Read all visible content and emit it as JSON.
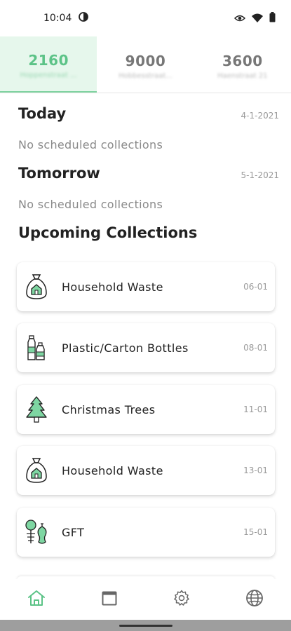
{
  "status_bar": {
    "time": "10:04",
    "icons": [
      "sync-icon",
      "eye-icon",
      "wifi-icon",
      "battery-icon"
    ]
  },
  "address_tabs": [
    {
      "number": "2160",
      "subtitle": "Hoppenstraat ...",
      "active": true
    },
    {
      "number": "9000",
      "subtitle": "Hobbesstraat...",
      "active": false
    },
    {
      "number": "3600",
      "subtitle": "Haenstraat 21",
      "active": false
    }
  ],
  "today": {
    "title": "Today",
    "date": "4-1-2021",
    "empty_text": "No scheduled collections"
  },
  "tomorrow": {
    "title": "Tomorrow",
    "date": "5-1-2021",
    "empty_text": "No scheduled collections"
  },
  "upcoming": {
    "title": "Upcoming Collections",
    "items": [
      {
        "label": "Household Waste",
        "date": "06-01",
        "icon": "household-waste-bag-icon"
      },
      {
        "label": "Plastic/Carton Bottles",
        "date": "08-01",
        "icon": "bottles-icon"
      },
      {
        "label": "Christmas Trees",
        "date": "11-01",
        "icon": "christmas-tree-icon"
      },
      {
        "label": "Household Waste",
        "date": "13-01",
        "icon": "household-waste-bag-icon"
      },
      {
        "label": "GFT",
        "date": "15-01",
        "icon": "gft-compost-icon"
      }
    ]
  },
  "bottom_nav": {
    "items": [
      "home-icon",
      "calendar-icon",
      "settings-gear-icon",
      "globe-icon"
    ],
    "active": "home-icon"
  },
  "colors": {
    "accent": "#5cc387",
    "accent_light": "#e6f7ec",
    "text": "#222222",
    "muted": "#999999"
  }
}
